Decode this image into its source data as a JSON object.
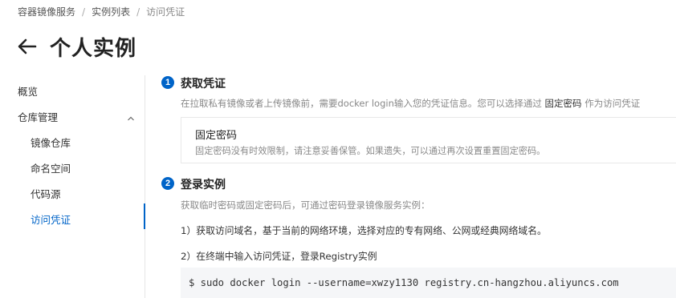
{
  "breadcrumb": {
    "items": [
      "容器镜像服务",
      "实例列表",
      "访问凭证"
    ],
    "separator": "/"
  },
  "header": {
    "back_icon": "arrow-left-icon",
    "title": "个人实例"
  },
  "sidebar": {
    "overview": "概览",
    "repo_group": "仓库管理",
    "repo_group_expanded": true,
    "items": [
      "镜像仓库",
      "命名空间",
      "代码源",
      "访问凭证"
    ],
    "active_item": "访问凭证",
    "accent_color": "#0064c8"
  },
  "main": {
    "step1": {
      "number": "1",
      "title": "获取凭证",
      "desc_prefix": "在拉取私有镜像或者上传镜像前，需要docker login输入您的凭证信息。您可以选择通过 ",
      "desc_strong": "固定密码",
      "desc_suffix": " 作为访问凭证",
      "card_title": "固定密码",
      "card_desc": "固定密码没有时效限制，请注意妥善保管。如果遗失，可以通过再次设置重置固定密码。"
    },
    "step2": {
      "number": "2",
      "title": "登录实例",
      "desc": "获取临时密码或固定密码后，可通过密码登录镜像服务实例：",
      "line1": "1）获取访问域名，基于当前的网络环境，选择对应的专有网络、公网或经典网络域名。",
      "line2": "2）在终端中输入访问凭证，登录Registry实例",
      "command": "$ sudo docker login --username=xwzy1130 registry.cn-hangzhou.aliyuncs.com"
    }
  }
}
